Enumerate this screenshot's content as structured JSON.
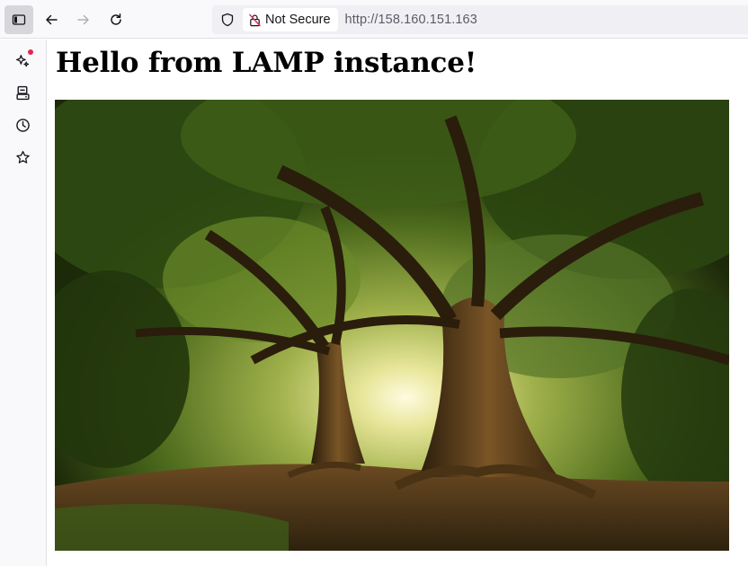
{
  "browser": {
    "toolbar": {
      "sidebar_toggle_icon": "sidebar-toggle-icon",
      "back_icon": "back-arrow-icon",
      "forward_icon": "forward-arrow-icon",
      "reload_icon": "reload-icon"
    },
    "urlbar": {
      "security_label": "Not Secure",
      "url": "http://158.160.151.163"
    },
    "sidebar": {
      "items": [
        {
          "icon": "ai-sparkle-icon",
          "has_notification": true
        },
        {
          "icon": "synced-tabs-icon"
        },
        {
          "icon": "history-icon"
        },
        {
          "icon": "bookmarks-star-icon"
        }
      ]
    }
  },
  "page": {
    "heading": "Hello from LAMP instance!",
    "image": {
      "subject": "tree-photo"
    }
  },
  "colors": {
    "toolbar_bg": "#f9f9fb",
    "urlbar_bg": "#f0f0f4",
    "notification_dot": "#e22850",
    "active_button_bg": "#d7d7db"
  }
}
